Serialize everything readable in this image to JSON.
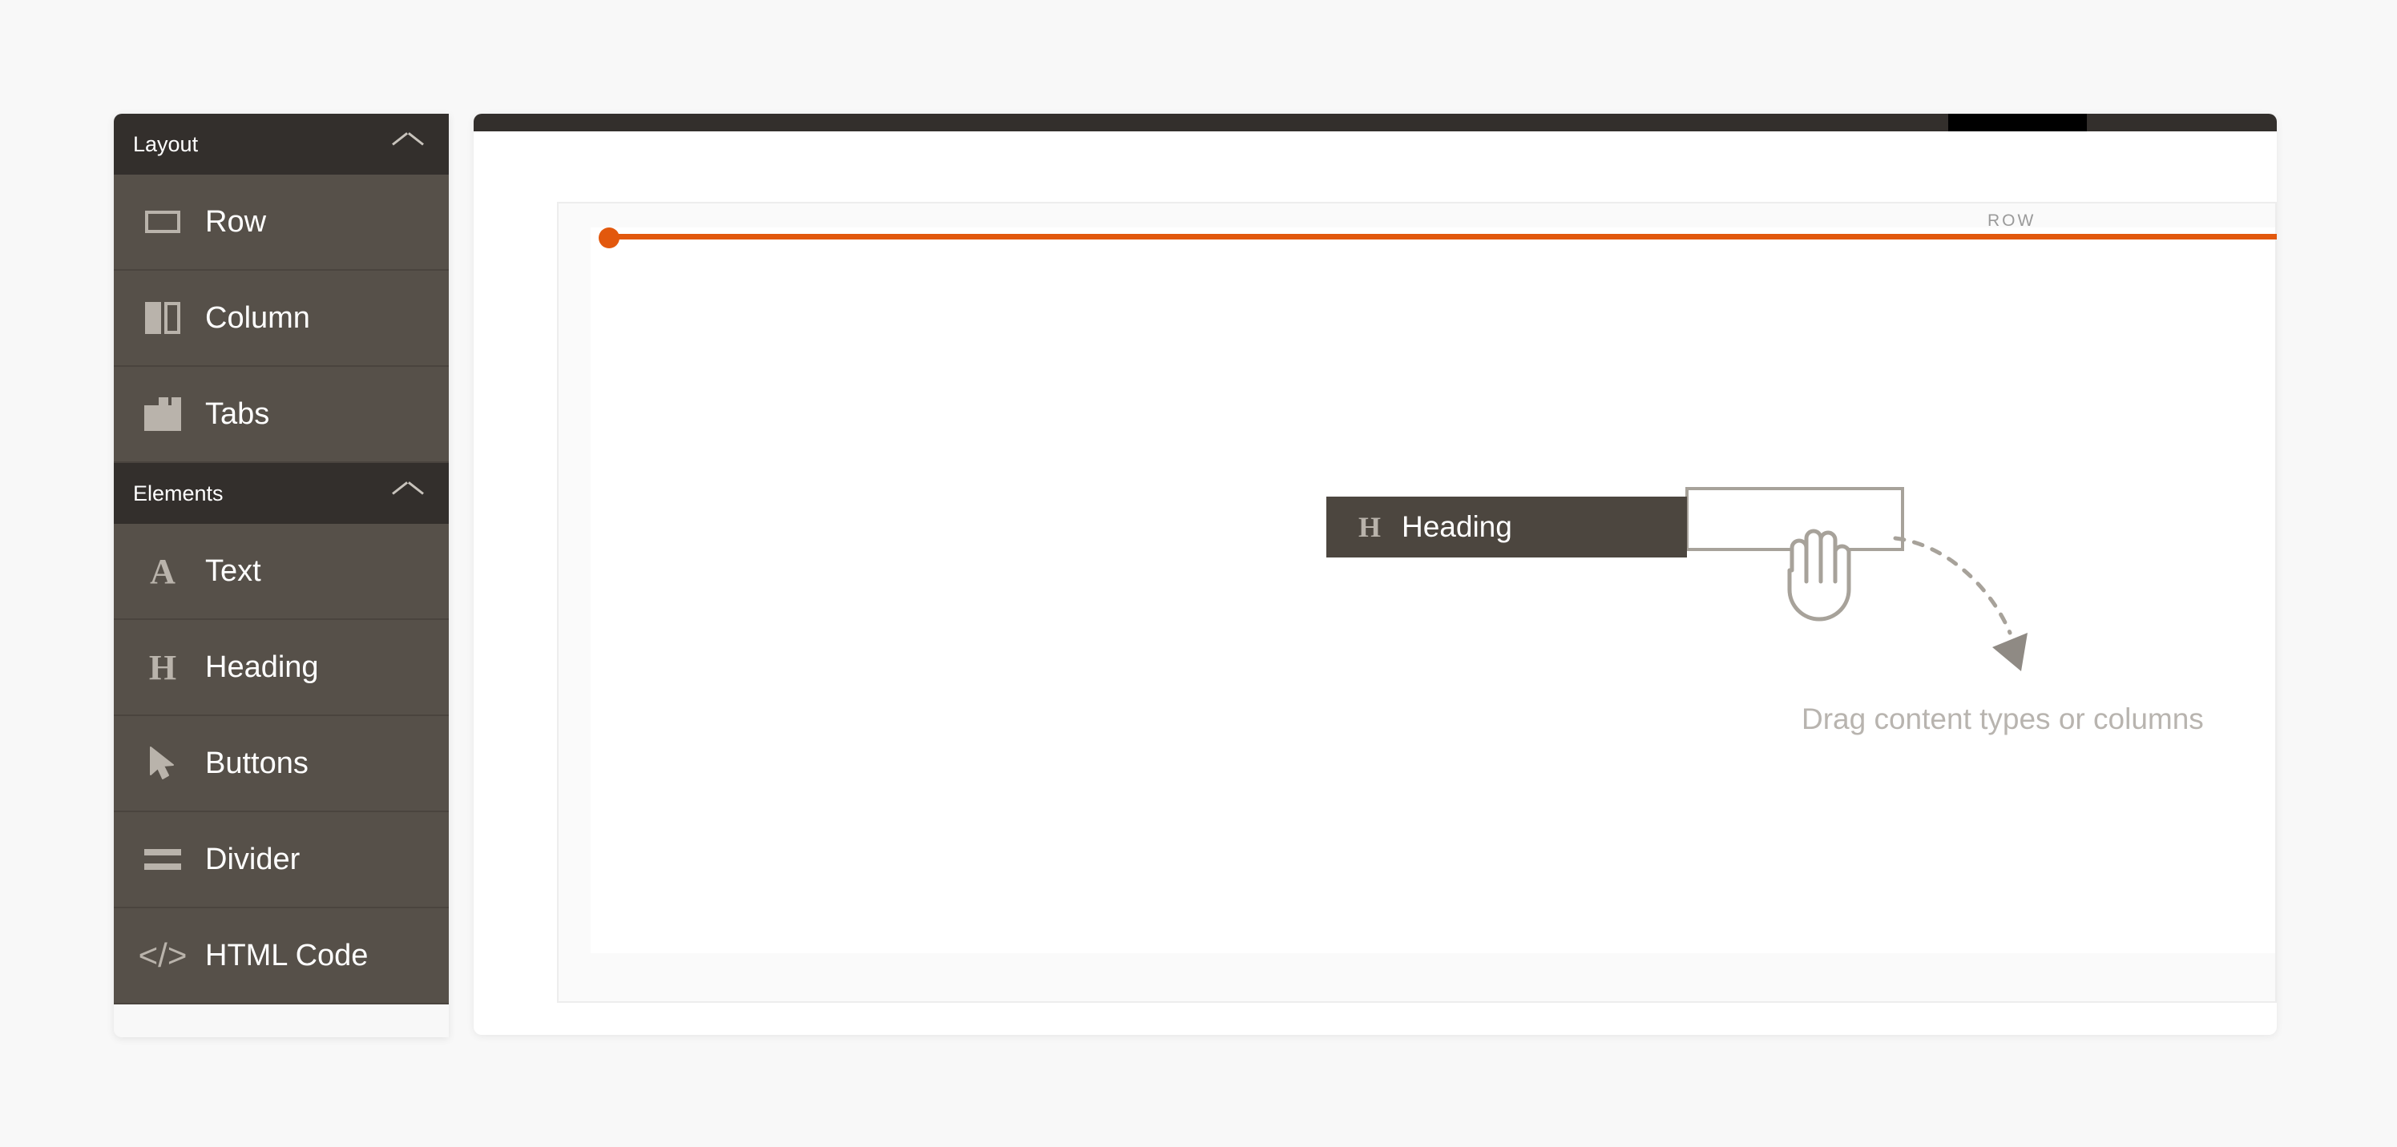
{
  "colors": {
    "accent_orange": "#e2580d",
    "sidebar_header_bg": "#332f2c",
    "sidebar_item_bg": "#565049",
    "page_bg": "#f8f8f8",
    "drag_chip_bg": "#4c463f",
    "hint_text": "#b8b4af",
    "row_label": "#9a9a9a"
  },
  "sidebar": {
    "sections": [
      {
        "title": "Layout",
        "collapse_icon": "chevron-up-icon",
        "items": [
          {
            "label": "Row",
            "icon": "row-icon"
          },
          {
            "label": "Column",
            "icon": "column-icon"
          },
          {
            "label": "Tabs",
            "icon": "tabs-icon"
          }
        ]
      },
      {
        "title": "Elements",
        "collapse_icon": "chevron-up-icon",
        "items": [
          {
            "label": "Text",
            "icon": "text-a-icon",
            "glyph": "A"
          },
          {
            "label": "Heading",
            "icon": "heading-h-icon",
            "glyph": "H"
          },
          {
            "label": "Buttons",
            "icon": "cursor-arrow-icon"
          },
          {
            "label": "Divider",
            "icon": "divider-icon"
          },
          {
            "label": "HTML Code",
            "icon": "html-code-icon",
            "glyph": "</>"
          }
        ]
      }
    ]
  },
  "canvas": {
    "row_label": "ROW",
    "drop_indicator": {
      "color": "#e2580d",
      "handle": "drag-handle-dot"
    },
    "drag_preview": {
      "icon": "heading-h-icon",
      "glyph": "H",
      "label": "Heading"
    },
    "cursor": "open-hand-cursor",
    "hint": "Drag content types or columns"
  }
}
